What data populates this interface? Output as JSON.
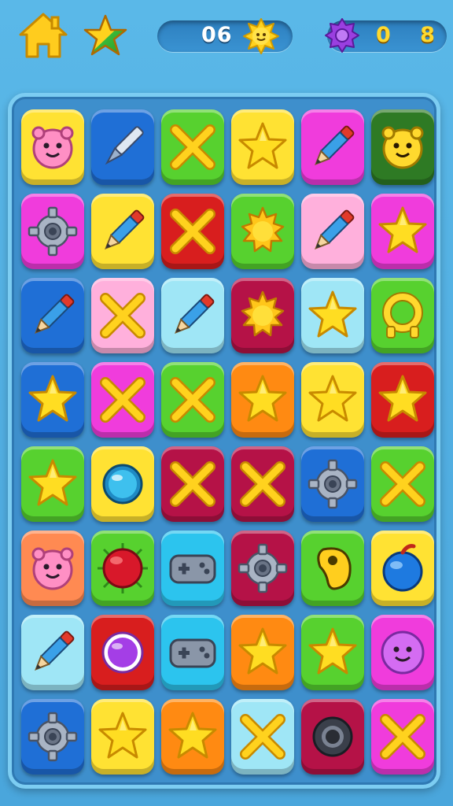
{
  "hud": {
    "moves_label": "06",
    "score_label": "0 8"
  },
  "colors": {
    "yellow": "#ffe233",
    "blue": "#1f6fd6",
    "green": "#57d12f",
    "magenta": "#f03cdc",
    "darkgreen": "#2e7a24",
    "red": "#d81e1e",
    "pink": "#ffb0dc",
    "lightblue": "#9fe6f6",
    "crimson": "#b51247",
    "orange": "#ff8a12",
    "salmon": "#ff8a52",
    "cyan": "#2cc4ee"
  },
  "board": {
    "rows": [
      [
        {
          "color": "yellow",
          "icon": "pink-face-icon"
        },
        {
          "color": "blue",
          "icon": "pen-icon"
        },
        {
          "color": "green",
          "icon": "x-icon"
        },
        {
          "color": "yellow",
          "icon": "star-icon"
        },
        {
          "color": "magenta",
          "icon": "pencil-icon"
        },
        {
          "color": "darkgreen",
          "icon": "yellow-face-icon"
        }
      ],
      [
        {
          "color": "magenta",
          "icon": "gear-icon"
        },
        {
          "color": "yellow",
          "icon": "pencil-icon"
        },
        {
          "color": "red",
          "icon": "x-icon"
        },
        {
          "color": "green",
          "icon": "sun-icon"
        },
        {
          "color": "pink",
          "icon": "pencil-icon"
        },
        {
          "color": "magenta",
          "icon": "star-icon"
        }
      ],
      [
        {
          "color": "blue",
          "icon": "pencil-icon"
        },
        {
          "color": "pink",
          "icon": "x-icon"
        },
        {
          "color": "lightblue",
          "icon": "pencil-icon"
        },
        {
          "color": "crimson",
          "icon": "sun-icon"
        },
        {
          "color": "lightblue",
          "icon": "star-icon"
        },
        {
          "color": "green",
          "icon": "ring-icon"
        }
      ],
      [
        {
          "color": "blue",
          "icon": "star-icon"
        },
        {
          "color": "magenta",
          "icon": "x-icon"
        },
        {
          "color": "green",
          "icon": "x-icon"
        },
        {
          "color": "orange",
          "icon": "star-icon"
        },
        {
          "color": "yellow",
          "icon": "star-icon"
        },
        {
          "color": "red",
          "icon": "star-icon"
        }
      ],
      [
        {
          "color": "green",
          "icon": "star-icon"
        },
        {
          "color": "yellow",
          "icon": "orb-icon"
        },
        {
          "color": "crimson",
          "icon": "x-icon"
        },
        {
          "color": "crimson",
          "icon": "x-icon"
        },
        {
          "color": "blue",
          "icon": "gear-icon"
        },
        {
          "color": "green",
          "icon": "x-icon"
        }
      ],
      [
        {
          "color": "salmon",
          "icon": "pink-face-icon"
        },
        {
          "color": "green",
          "icon": "red-ball-icon"
        },
        {
          "color": "cyan",
          "icon": "gamepad-icon"
        },
        {
          "color": "crimson",
          "icon": "gear-icon"
        },
        {
          "color": "green",
          "icon": "drop-icon"
        },
        {
          "color": "yellow",
          "icon": "blue-ball-icon"
        }
      ],
      [
        {
          "color": "lightblue",
          "icon": "pencil-icon"
        },
        {
          "color": "red",
          "icon": "purple-orb-icon"
        },
        {
          "color": "cyan",
          "icon": "gamepad-icon"
        },
        {
          "color": "orange",
          "icon": "star-icon"
        },
        {
          "color": "green",
          "icon": "star-icon"
        },
        {
          "color": "magenta",
          "icon": "purple-face-icon"
        }
      ],
      [
        {
          "color": "blue",
          "icon": "gear-icon"
        },
        {
          "color": "yellow",
          "icon": "star-icon"
        },
        {
          "color": "orange",
          "icon": "star-icon"
        },
        {
          "color": "lightblue",
          "icon": "x-icon"
        },
        {
          "color": "crimson",
          "icon": "ring-dark-icon"
        },
        {
          "color": "magenta",
          "icon": "x-icon"
        }
      ]
    ]
  }
}
